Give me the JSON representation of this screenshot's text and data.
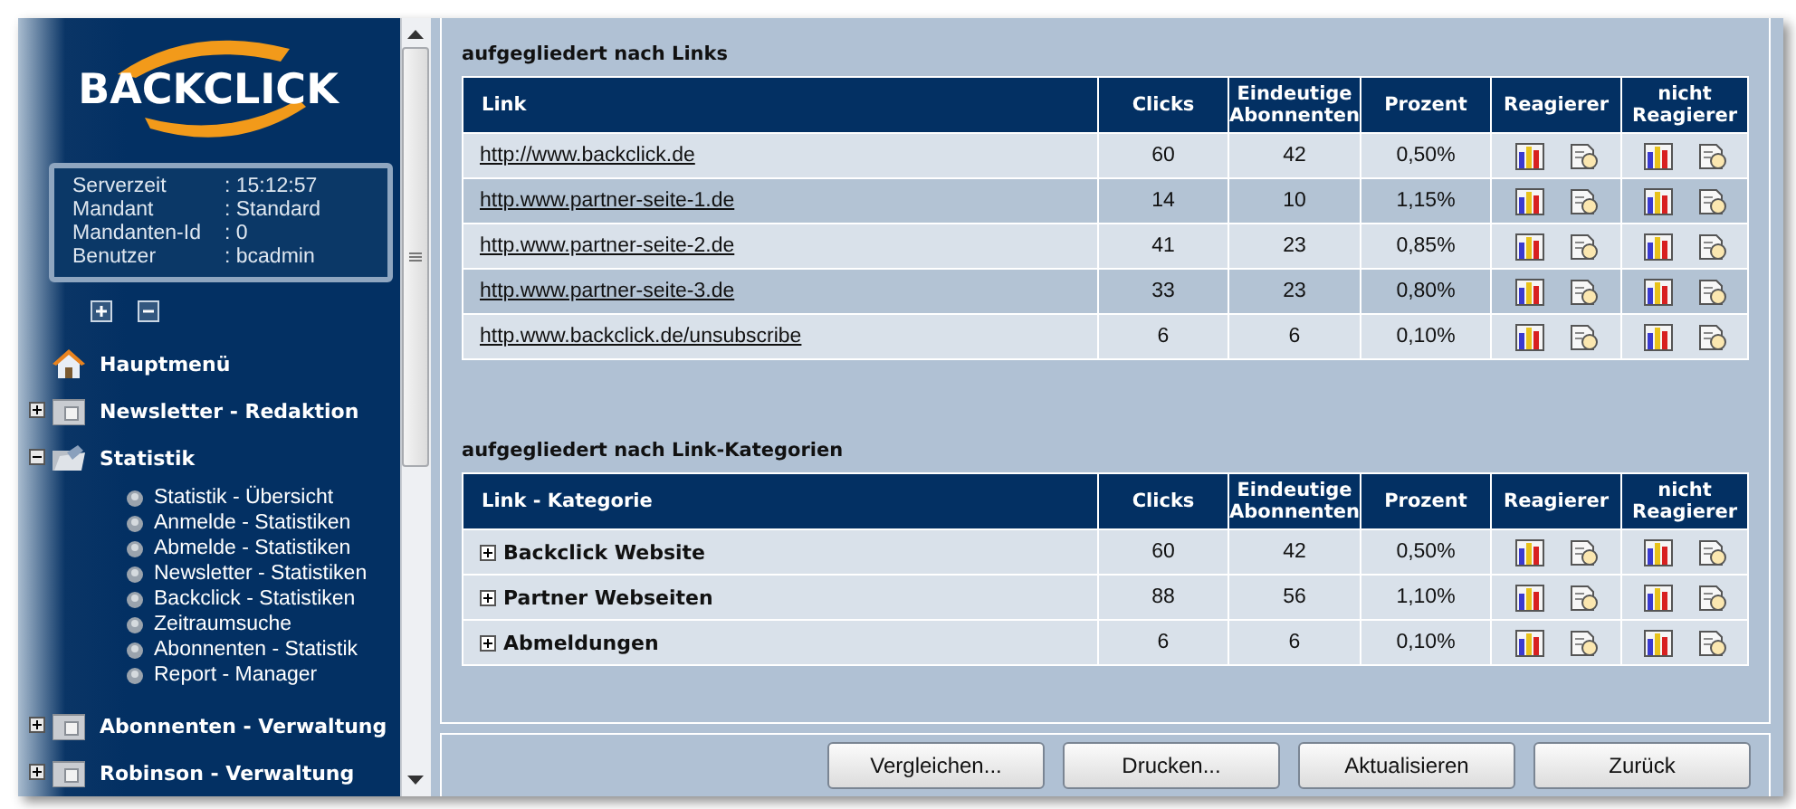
{
  "logo": {
    "text": "BACKCLICK"
  },
  "server_info": [
    {
      "label": "Serverzeit",
      "value": ":  15:12:57"
    },
    {
      "label": "Mandant",
      "value": ": Standard"
    },
    {
      "label": "Mandanten-Id",
      "value": ": 0"
    },
    {
      "label": "Benutzer",
      "value": ": bcadmin"
    }
  ],
  "menu": [
    {
      "kind": "home",
      "label": "Hauptmenü"
    },
    {
      "kind": "folder",
      "label": "Newsletter - Redaktion",
      "expanded": false
    },
    {
      "kind": "folder",
      "label": "Statistik",
      "expanded": true,
      "children": [
        {
          "label": "Statistik - Übersicht"
        },
        {
          "label": "Anmelde - Statistiken"
        },
        {
          "label": "Abmelde - Statistiken"
        },
        {
          "label": "Newsletter - Statistiken"
        },
        {
          "label": "Backclick - Statistiken"
        },
        {
          "label": "Zeitraumsuche"
        },
        {
          "label": "Abonnenten - Statistik"
        },
        {
          "label": "Report - Manager"
        }
      ]
    },
    {
      "kind": "folder",
      "label": "Abonnenten - Verwaltung",
      "expanded": false
    },
    {
      "kind": "folder",
      "label": "Robinson - Verwaltung",
      "expanded": false
    }
  ],
  "sections": [
    {
      "title": "aufgegliedert nach Links",
      "striped": true,
      "columns": [
        "Link",
        "Clicks",
        "Eindeutige Abonnenten",
        "Prozent",
        "Reagierer",
        "nicht Reagierer"
      ],
      "rows": [
        {
          "kind": "link",
          "name": "http://www.backclick.de",
          "clicks": "60",
          "unique": "42",
          "percent": "0,50%"
        },
        {
          "kind": "link",
          "name": "http.www.partner-seite-1.de",
          "clicks": "14",
          "unique": "10",
          "percent": "1,15%"
        },
        {
          "kind": "link",
          "name": "http.www.partner-seite-2.de",
          "clicks": "41",
          "unique": "23",
          "percent": "0,85%"
        },
        {
          "kind": "link",
          "name": "http.www.partner-seite-3.de",
          "clicks": "33",
          "unique": "23",
          "percent": "0,80%"
        },
        {
          "kind": "link",
          "name": "http.www.backclick.de/unsubscribe",
          "clicks": "6",
          "unique": "6",
          "percent": "0,10%"
        }
      ]
    },
    {
      "title": "aufgegliedert nach Link-Kategorien",
      "striped": false,
      "columns": [
        "Link - Kategorie",
        "Clicks",
        "Eindeutige Abonnenten",
        "Prozent",
        "Reagierer",
        "nicht Reagierer"
      ],
      "rows": [
        {
          "kind": "category",
          "name": "Backclick Website",
          "expanded": false,
          "clicks": "60",
          "unique": "42",
          "percent": "0,50%"
        },
        {
          "kind": "category",
          "name": "Partner Webseiten",
          "expanded": false,
          "clicks": "88",
          "unique": "56",
          "percent": "1,10%"
        },
        {
          "kind": "category",
          "name": "Abmeldungen",
          "expanded": false,
          "clicks": "6",
          "unique": "6",
          "percent": "0,10%"
        }
      ]
    }
  ],
  "buttons": [
    "Vergleichen...",
    "Drucken...",
    "Aktualisieren",
    "Zurück"
  ]
}
